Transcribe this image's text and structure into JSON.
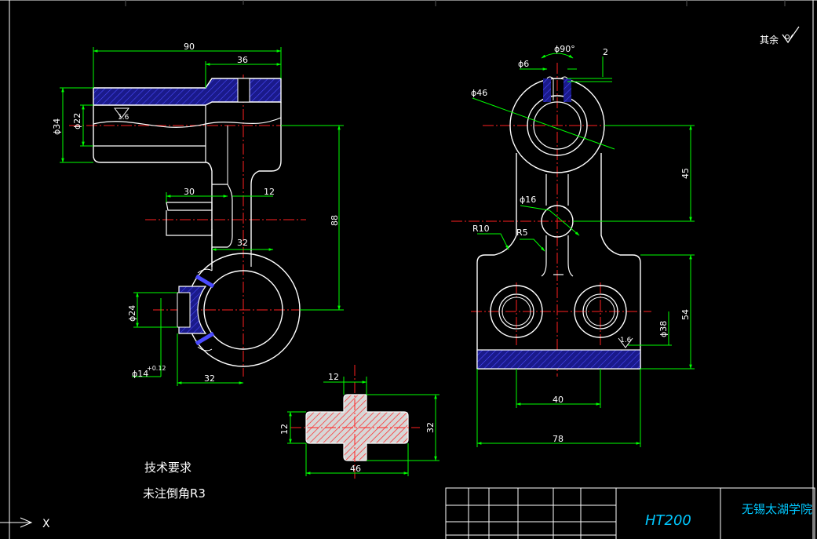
{
  "surface_roughness_note": "其余",
  "left_view": {
    "dims": {
      "overall_width": "90",
      "boss_width": "36",
      "bore_dia": "ϕ34",
      "inner_dia": "ϕ22",
      "roughness": "1.6",
      "arm_width": "30",
      "slot": "12",
      "rib": "32",
      "height": "88",
      "hole_dia": "ϕ24",
      "tol_hole": "ϕ14",
      "tol_value": "+0.12",
      "bottom_width": "32"
    }
  },
  "right_view": {
    "dims": {
      "angle": "ϕ90°",
      "small_hole": "ϕ6",
      "gap": "2",
      "outer_dia": "ϕ46",
      "center_height": "45",
      "mid_hole": "ϕ16",
      "radius_10": "R10",
      "radius_5": "R5",
      "base_height": "54",
      "roughness": "1.6",
      "base_hole": "ϕ38",
      "hole_spacing": "40",
      "base_width": "78"
    }
  },
  "section_view": {
    "dims": {
      "rib_width": "12",
      "rib_thickness": "12",
      "height": "32",
      "width": "46"
    }
  },
  "notes": {
    "title": "技术要求",
    "line1": "未注倒角R3"
  },
  "title_block": {
    "material": "HT200",
    "school": "无锡太湖学院"
  },
  "ucs_label": "X"
}
